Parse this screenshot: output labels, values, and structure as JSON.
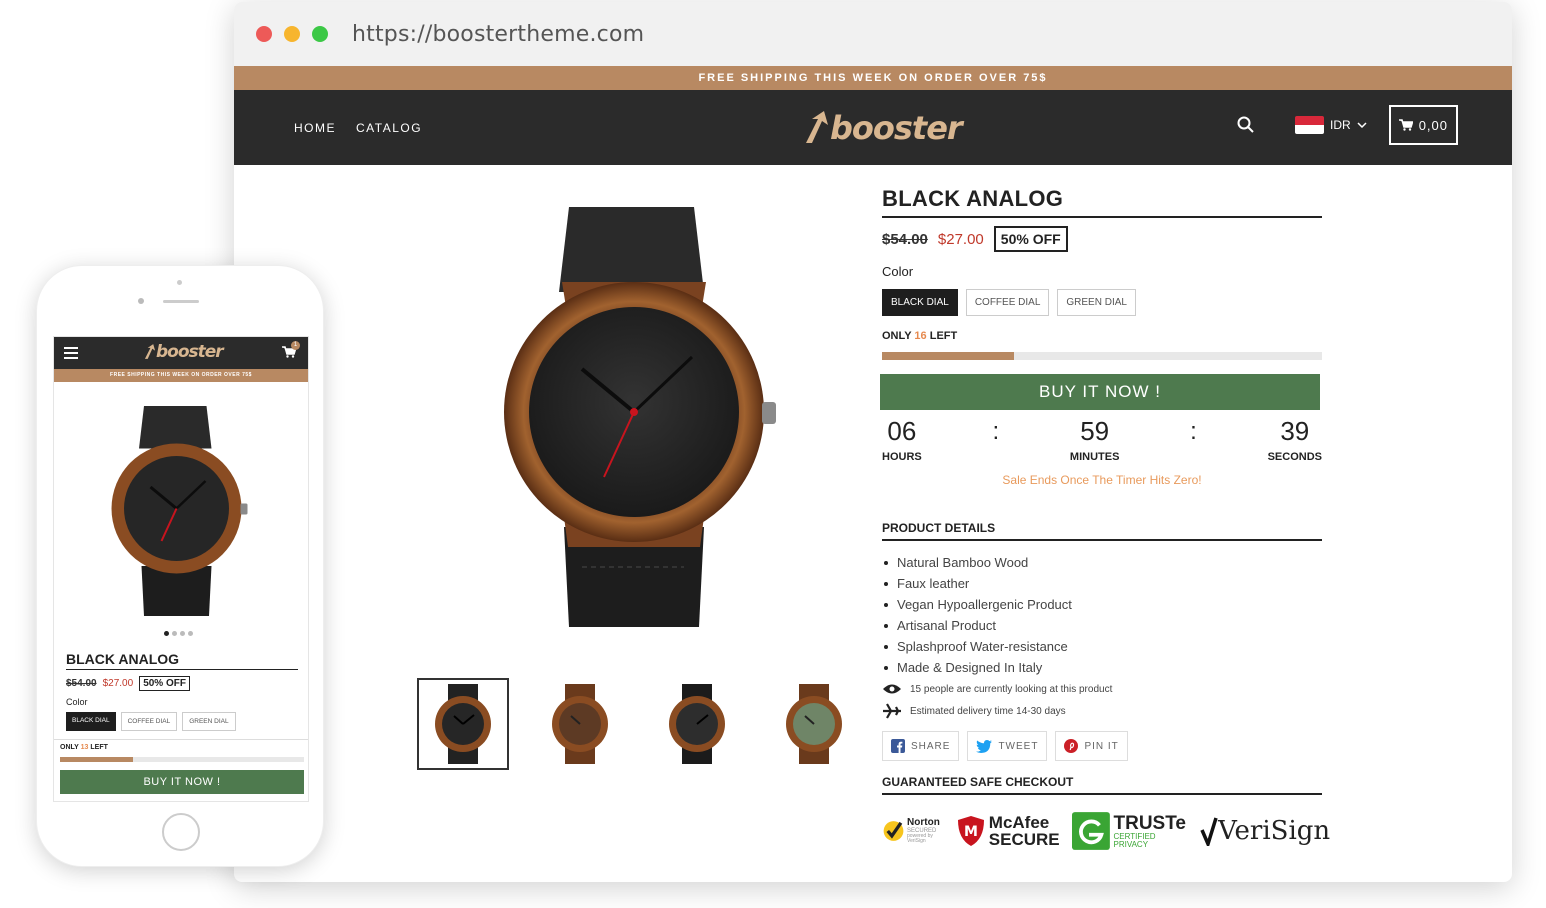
{
  "browser": {
    "url": "https://boostertheme.com",
    "dots": [
      "#ed5a58",
      "#f7b52e",
      "#3cc846"
    ]
  },
  "store": {
    "promo": "FREE SHIPPING THIS WEEK ON ORDER OVER 75$",
    "nav": [
      "HOME",
      "CATALOG"
    ],
    "logo": "booster",
    "currency": "IDR",
    "cart_total": "0,00"
  },
  "product": {
    "title": "BLACK ANALOG",
    "old_price": "$54.00",
    "new_price": "$27.00",
    "discount": "50% OFF",
    "color_label": "Color",
    "colors": [
      "BLACK DIAL",
      "COFFEE DIAL",
      "GREEN DIAL"
    ],
    "stock_prefix": "ONLY",
    "stock_count": "16",
    "stock_suffix": "LEFT",
    "stock_fraction": 0.3,
    "buy_label": "BUY IT NOW !",
    "timer": {
      "hours": "06",
      "hours_label": "HOURS",
      "minutes": "59",
      "minutes_label": "MINUTES",
      "seconds": "39",
      "seconds_label": "SECONDS",
      "sep": ":"
    },
    "sale_ends": "Sale Ends Once The Timer Hits Zero!",
    "details_heading": "PRODUCT DETAILS",
    "details": [
      "Natural Bamboo Wood",
      "Faux leather",
      "Vegan Hypoallergenic Product",
      "Artisanal Product",
      "Splashproof Water-resistance",
      "Made & Designed In Italy"
    ],
    "viewing": "15 people are currently looking at this product",
    "delivery": "Estimated delivery time 14-30 days",
    "share": [
      "SHARE",
      "TWEET",
      "PIN IT"
    ],
    "checkout_heading": "GUARANTEED SAFE CHECKOUT",
    "badges": {
      "norton": "Norton",
      "norton_sub": "SECURED",
      "norton_tag": "powered by VeriSign",
      "mcafee": "McAfee",
      "mcafee_sub": "SECURE",
      "truste": "TRUSTe",
      "truste_sub": "CERTIFIED PRIVACY",
      "verisign": "VeriSign"
    }
  },
  "mobile": {
    "promo": "FREE SHIPPING THIS WEEK ON ORDER OVER 75$",
    "logo": "booster",
    "cart_badge": "1",
    "title": "BLACK ANALOG",
    "old_price": "$54.00",
    "new_price": "$27.00",
    "discount": "50% OFF",
    "color_label": "Color",
    "colors": [
      "BLACK DIAL",
      "COFFEE DIAL",
      "GREEN DIAL"
    ],
    "stock_prefix": "ONLY",
    "stock_count": "13",
    "stock_suffix": "LEFT",
    "stock_fraction": 0.3,
    "buy_label": "BUY IT NOW !"
  },
  "colors": {
    "accent": "#b88962",
    "dark": "#2b2b2b",
    "buy": "#4e7a4e",
    "sale": "#c0392b"
  }
}
